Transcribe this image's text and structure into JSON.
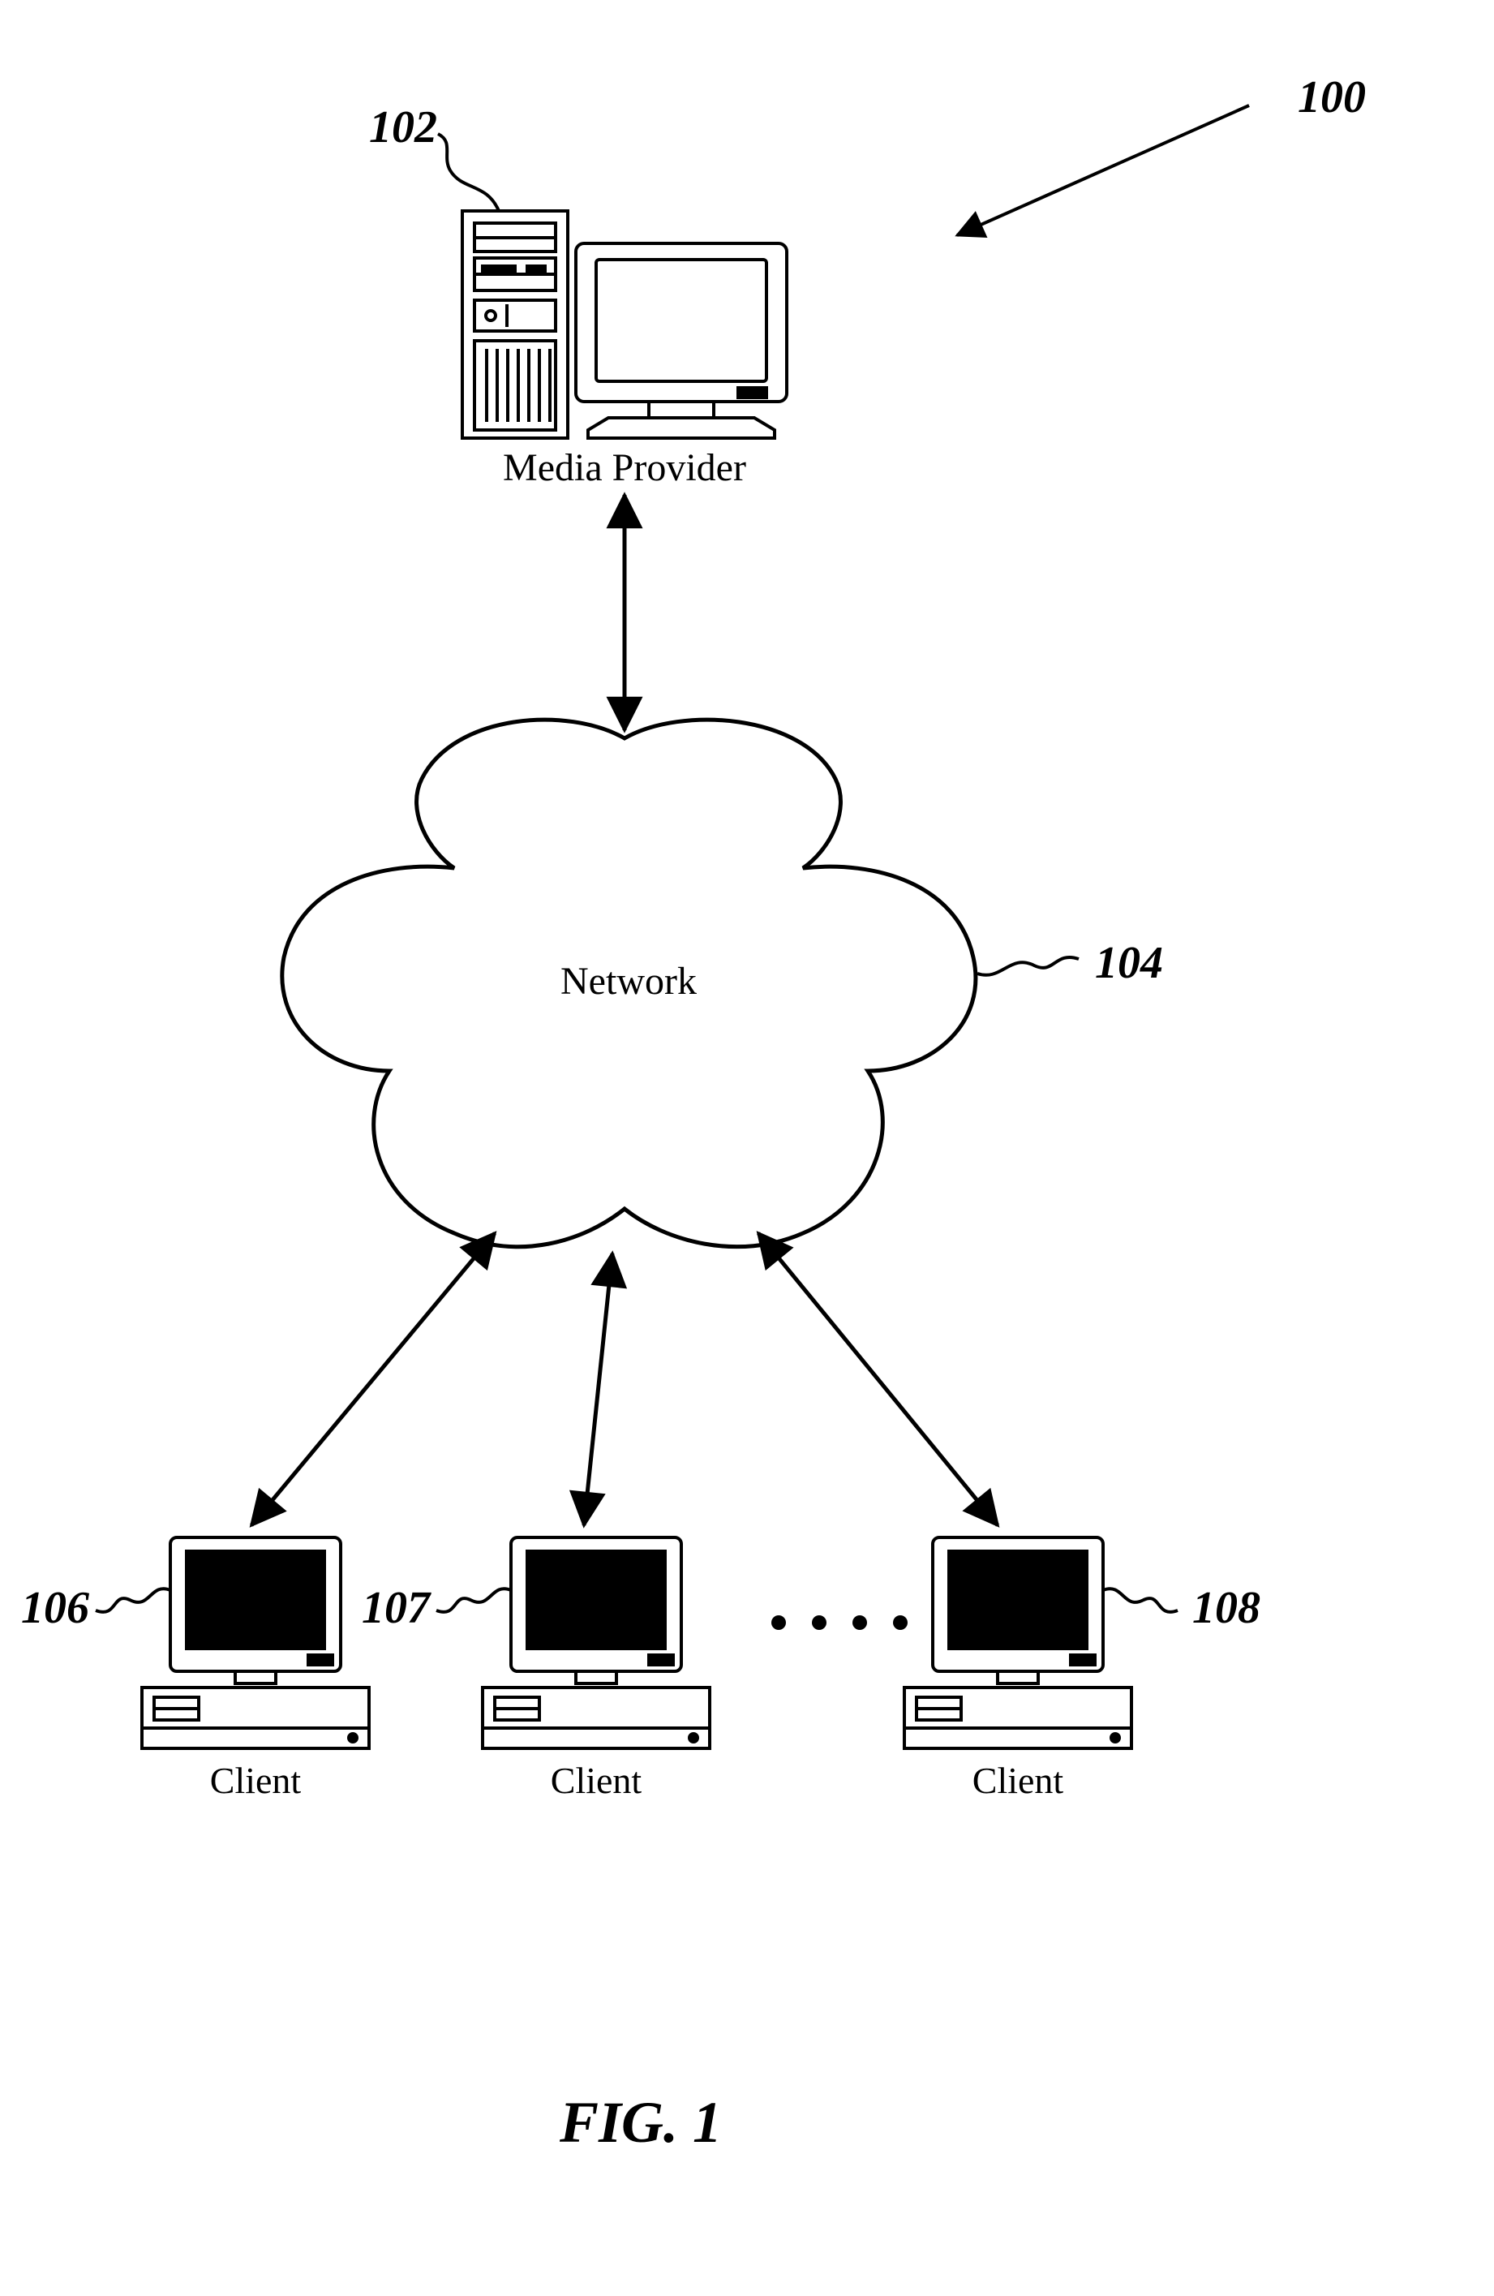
{
  "figure_label": "FIG. 1",
  "refnums": {
    "system": "100",
    "media_provider": "102",
    "network": "104",
    "client1": "106",
    "client2": "107",
    "client3": "108"
  },
  "labels": {
    "media_provider": "Media Provider",
    "network": "Network",
    "client": "Client"
  }
}
